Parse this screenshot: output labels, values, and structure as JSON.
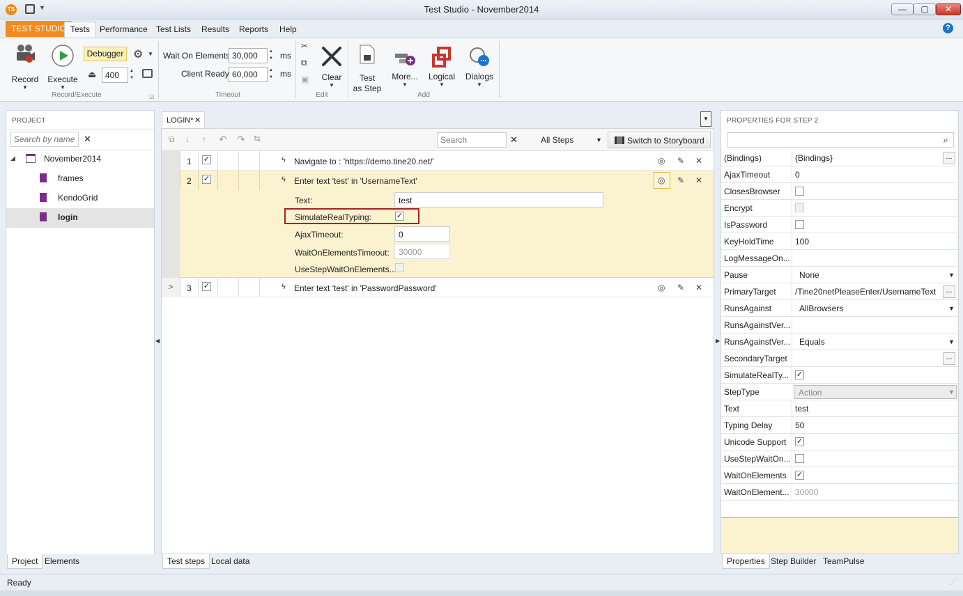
{
  "window": {
    "title": "Test Studio - November2014",
    "app_icon": "TS",
    "minimize": "—",
    "maximize": "▢",
    "close": "✕"
  },
  "menu": {
    "brand": "TEST STUDIO",
    "items": [
      "Tests",
      "Performance",
      "Test Lists",
      "Results",
      "Reports",
      "Help"
    ],
    "help_glyph": "?"
  },
  "ribbon": {
    "record_label": "Record",
    "execute_label": "Execute",
    "debugger_label": "Debugger",
    "speed_value": "400",
    "group_record_execute": "Record/Execute",
    "wait_on_elements_label": "Wait On Elements",
    "wait_on_elements_value": "30,000",
    "client_ready_label": "Client Ready",
    "client_ready_value": "60,000",
    "ms": "ms",
    "group_timeout": "Timeout",
    "clear_label": "Clear",
    "group_edit": "Edit",
    "test_as_step_label1": "Test",
    "test_as_step_label2": "as Step",
    "more_label": "More...",
    "logical_label": "Logical",
    "dialogs_label": "Dialogs",
    "group_add": "Add"
  },
  "project": {
    "header": "PROJECT",
    "search_placeholder": "Search by name",
    "root": "November2014",
    "items": [
      "frames",
      "KendoGrid",
      "login"
    ],
    "tabs": [
      "Project",
      "Elements"
    ]
  },
  "editor": {
    "tab": "LOGIN*",
    "search_placeholder": "Search",
    "filter_value": "All Steps",
    "storyboard_label": "Switch to Storyboard",
    "steps": [
      {
        "num": "1",
        "desc": "Navigate to : 'https://demo.tine20.net/'"
      },
      {
        "num": "2",
        "desc": "Enter text 'test' in 'UsernameText'"
      },
      {
        "num": "3",
        "desc": "Enter text 'test' in 'PasswordPassword'"
      }
    ],
    "detail": {
      "text_label": "Text:",
      "text_value": "test",
      "simulate_label": "SimulateRealTyping:",
      "ajax_label": "AjaxTimeout:",
      "ajax_value": "0",
      "wait_label": "WaitOnElementsTimeout:",
      "wait_value": "30000",
      "usestep_label": "UseStepWaitOnElements..."
    },
    "tabs": [
      "Test steps",
      "Local data"
    ]
  },
  "properties": {
    "header": "PROPERTIES FOR STEP 2",
    "rows": [
      {
        "name": "(Bindings)",
        "value": "{Bindings}"
      },
      {
        "name": "AjaxTimeout",
        "value": "0"
      },
      {
        "name": "ClosesBrowser",
        "value": ""
      },
      {
        "name": "Encrypt",
        "value": ""
      },
      {
        "name": "IsPassword",
        "value": ""
      },
      {
        "name": "KeyHoldTime",
        "value": "100"
      },
      {
        "name": "LogMessageOn...",
        "value": ""
      },
      {
        "name": "Pause",
        "value": "None"
      },
      {
        "name": "PrimaryTarget",
        "value": "/Tine20netPleaseEnter/UsernameText"
      },
      {
        "name": "RunsAgainst",
        "value": "AllBrowsers"
      },
      {
        "name": "RunsAgainstVer...",
        "value": ""
      },
      {
        "name": "RunsAgainstVer...",
        "value": "Equals"
      },
      {
        "name": "SecondaryTarget",
        "value": ""
      },
      {
        "name": "SimulateRealTy...",
        "value": ""
      },
      {
        "name": "StepType",
        "value": "Action"
      },
      {
        "name": "Text",
        "value": "test"
      },
      {
        "name": "Typing Delay",
        "value": "50"
      },
      {
        "name": "Unicode Support",
        "value": ""
      },
      {
        "name": "UseStepWaitOn...",
        "value": ""
      },
      {
        "name": "WaitOnElements",
        "value": ""
      },
      {
        "name": "WaitOnElement...",
        "value": "30000"
      }
    ],
    "tabs": [
      "Properties",
      "Step Builder",
      "TeamPulse"
    ]
  },
  "status": {
    "text": "Ready"
  },
  "colors": {
    "brand": "#f28b1d",
    "highlight": "#fbf2d0",
    "accent_border": "#a02626"
  }
}
